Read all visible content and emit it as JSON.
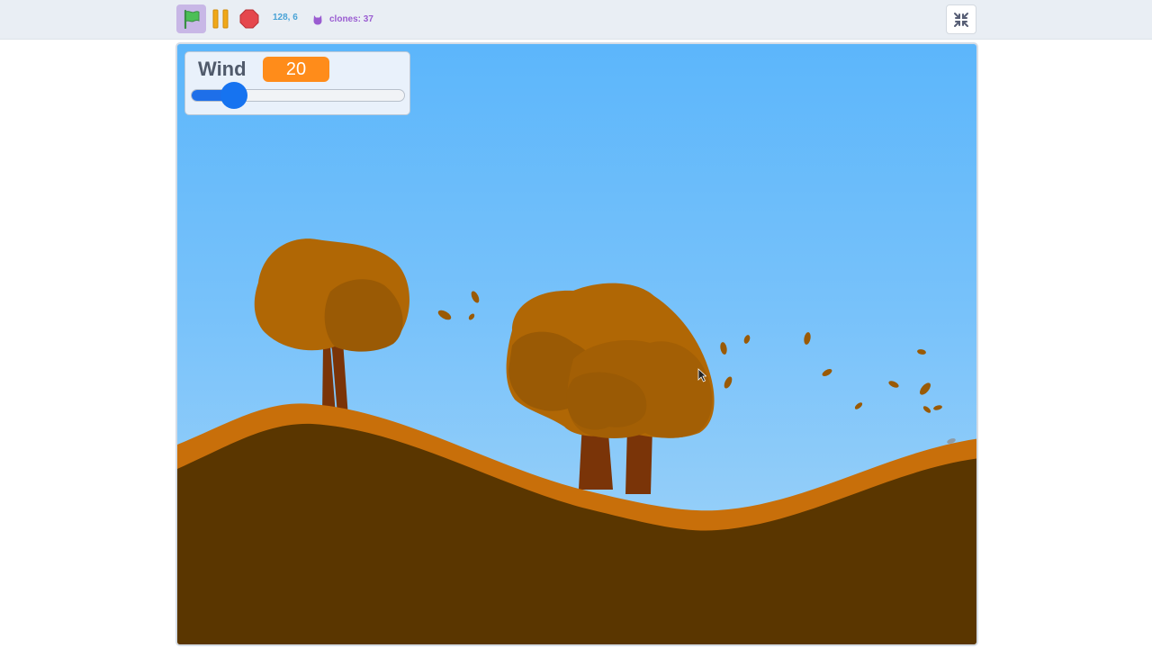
{
  "toolbar": {
    "green_flag_icon": "green-flag-icon",
    "pause_icon": "pause-icon",
    "stop_icon": "stop-icon",
    "coordinates": "128, 6",
    "clones_label": "clones: 37",
    "unfullscreen_icon": "unfullscreen-icon"
  },
  "monitor": {
    "label": "Wind",
    "value": "20",
    "slider_level": 0.2
  },
  "colors": {
    "flag": "#4cbf56",
    "pause": "#f0a819",
    "stop": "#e5474d",
    "monitor_value_bg": "#ff8c1a",
    "slider": "#1673f0",
    "sky_top": "#5cb6fb",
    "ground_top": "#c86f0a",
    "ground": "#5a3600",
    "foliage": "#b06705",
    "trunk": "#7a3408"
  }
}
